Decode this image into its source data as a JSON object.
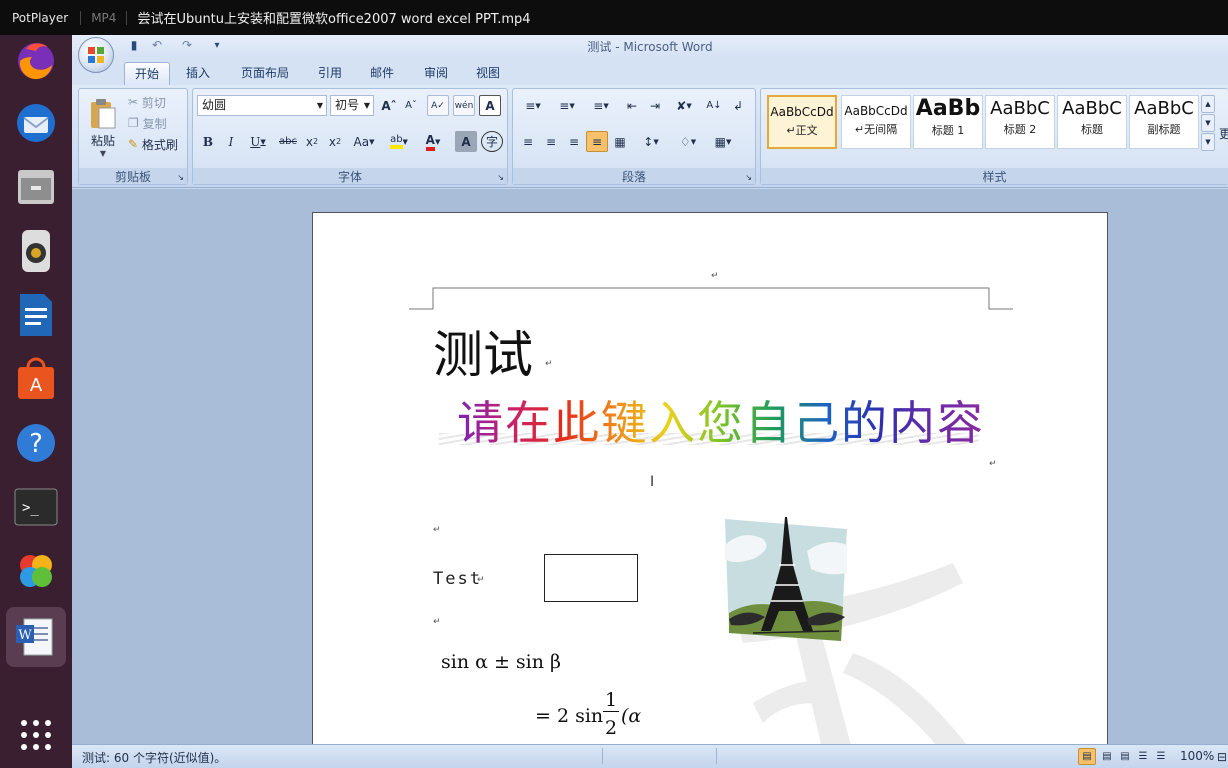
{
  "player": {
    "app_name": "PotPlayer",
    "format": "MP4",
    "file_title": "尝试在Ubuntu上安装和配置微软office2007 word excel PPT.mp4"
  },
  "dock": {
    "items": [
      {
        "name": "Firefox",
        "icon": "firefox-icon"
      },
      {
        "name": "Thunderbird",
        "icon": "thunderbird-icon"
      },
      {
        "name": "Files",
        "icon": "files-icon"
      },
      {
        "name": "Rhythmbox",
        "icon": "speaker-icon"
      },
      {
        "name": "LibreOffice Writer",
        "icon": "writer-icon"
      },
      {
        "name": "Ubuntu Software",
        "icon": "software-icon"
      },
      {
        "name": "Help",
        "icon": "help-icon"
      },
      {
        "name": "Terminal",
        "icon": "terminal-icon"
      },
      {
        "name": "CrossOver",
        "icon": "crossover-icon"
      },
      {
        "name": "Word",
        "icon": "word-icon"
      },
      {
        "name": "Show Applications",
        "icon": "app-grid-icon"
      }
    ]
  },
  "word": {
    "window_title": "测试 - Microsoft Word",
    "tabs": [
      "开始",
      "插入",
      "页面布局",
      "引用",
      "邮件",
      "审阅",
      "视图"
    ],
    "clipboard": {
      "paste": "粘贴",
      "cut": "剪切",
      "copy": "复制",
      "format_painter": "格式刷",
      "title": "剪贴板"
    },
    "font": {
      "font_name": "幼圆",
      "font_size": "初号",
      "title": "字体"
    },
    "paragraph": {
      "title": "段落"
    },
    "styles": {
      "title": "样式",
      "more": "更",
      "items": [
        {
          "preview": "AaBbCcDd",
          "name": "↵正文"
        },
        {
          "preview": "AaBbCcDd",
          "name": "↵无间隔"
        },
        {
          "preview": "AaBb",
          "name": "标题 1"
        },
        {
          "preview": "AaBbC",
          "name": "标题 2"
        },
        {
          "preview": "AaBbC",
          "name": "标题"
        },
        {
          "preview": "AaBbC",
          "name": "副标题"
        }
      ]
    },
    "document": {
      "heading": "测试",
      "wordart": "请在此键入您自己的内容",
      "test_label": "Test",
      "formula_line1": "sin α ± sin β",
      "formula_line2": "= 2 sin",
      "fraction_num": "1",
      "fraction_den": "2",
      "formula_tail": "(α"
    },
    "status": {
      "text": "测试: 60 个字符(近似值)。",
      "zoom": "100%"
    }
  }
}
